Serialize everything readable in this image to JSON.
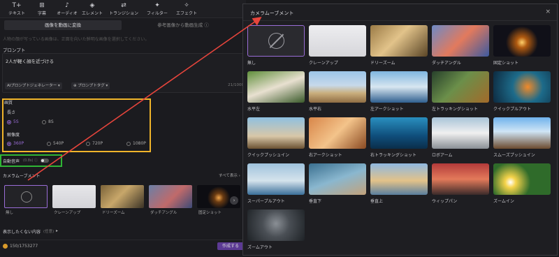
{
  "toolbar": {
    "items": [
      {
        "icon": "T+",
        "label": "テキスト"
      },
      {
        "icon": "⊞",
        "label": "字幕"
      },
      {
        "icon": "♪",
        "label": "オーディオ"
      },
      {
        "icon": "◈",
        "label": "エレメント"
      },
      {
        "icon": "⇄",
        "label": "トランジション"
      },
      {
        "icon": "✦",
        "label": "フィルター"
      },
      {
        "icon": "✧",
        "label": "エフェクト"
      }
    ]
  },
  "tabs": {
    "image_to_video": "画像を動画に変換",
    "reference_to_video": "参考画像から動画生成 ⓘ"
  },
  "note": "人物の顔が写っている画像は、正面を向いた鮮明な画像を選択してください。",
  "prompt": {
    "label": "プロンプト",
    "value": "2人が軽く顔を近づける",
    "generator_chip": "AIプロンプトジェネレーター ▾",
    "tag_chip": "⊕ プロンプトタグ ▾",
    "counter": "21/1000"
  },
  "quality": {
    "label": "画質",
    "length_label": "長さ",
    "length_options": [
      "5S",
      "8S"
    ],
    "resolution_label": "解像度",
    "resolution_options": [
      "360P",
      "540P",
      "720P",
      "1080P"
    ]
  },
  "auto_audio": {
    "label": "自動音声",
    "note": "(0.8s) ⓘ"
  },
  "camera": {
    "label": "カメラムーブメント",
    "show_all": "すべて表示 ›",
    "items": [
      "無し",
      "クレーンアップ",
      "ドリーズーム",
      "ダッチアングル",
      "固定ショット"
    ]
  },
  "negative": {
    "label": "表示したくない内容",
    "note": "(任意)"
  },
  "footer": {
    "credits": "150/1753277",
    "generate": "作成する"
  },
  "modal": {
    "title": "カメラムーブメント",
    "close": "×",
    "options": [
      "無し",
      "クレーンアップ",
      "ドリーズーム",
      "ダッチアングル",
      "固定ショット",
      "水平左",
      "水平右",
      "左アークショット",
      "左トラッキングショット",
      "クイックプルアウト",
      "クイックプッシュイン",
      "右アークショット",
      "右トラッキングショット",
      "ロボアーム",
      "スムーズプッシュイン",
      "スーパープルアウト",
      "垂直下",
      "垂直上",
      "ウィップパン",
      "ズームイン",
      "ズームアウト"
    ]
  },
  "colors": {
    "accent": "#9a6dd7",
    "highlight_yellow": "#f1b52a",
    "highlight_green": "#2fb535",
    "arrow": "#e8453c"
  }
}
